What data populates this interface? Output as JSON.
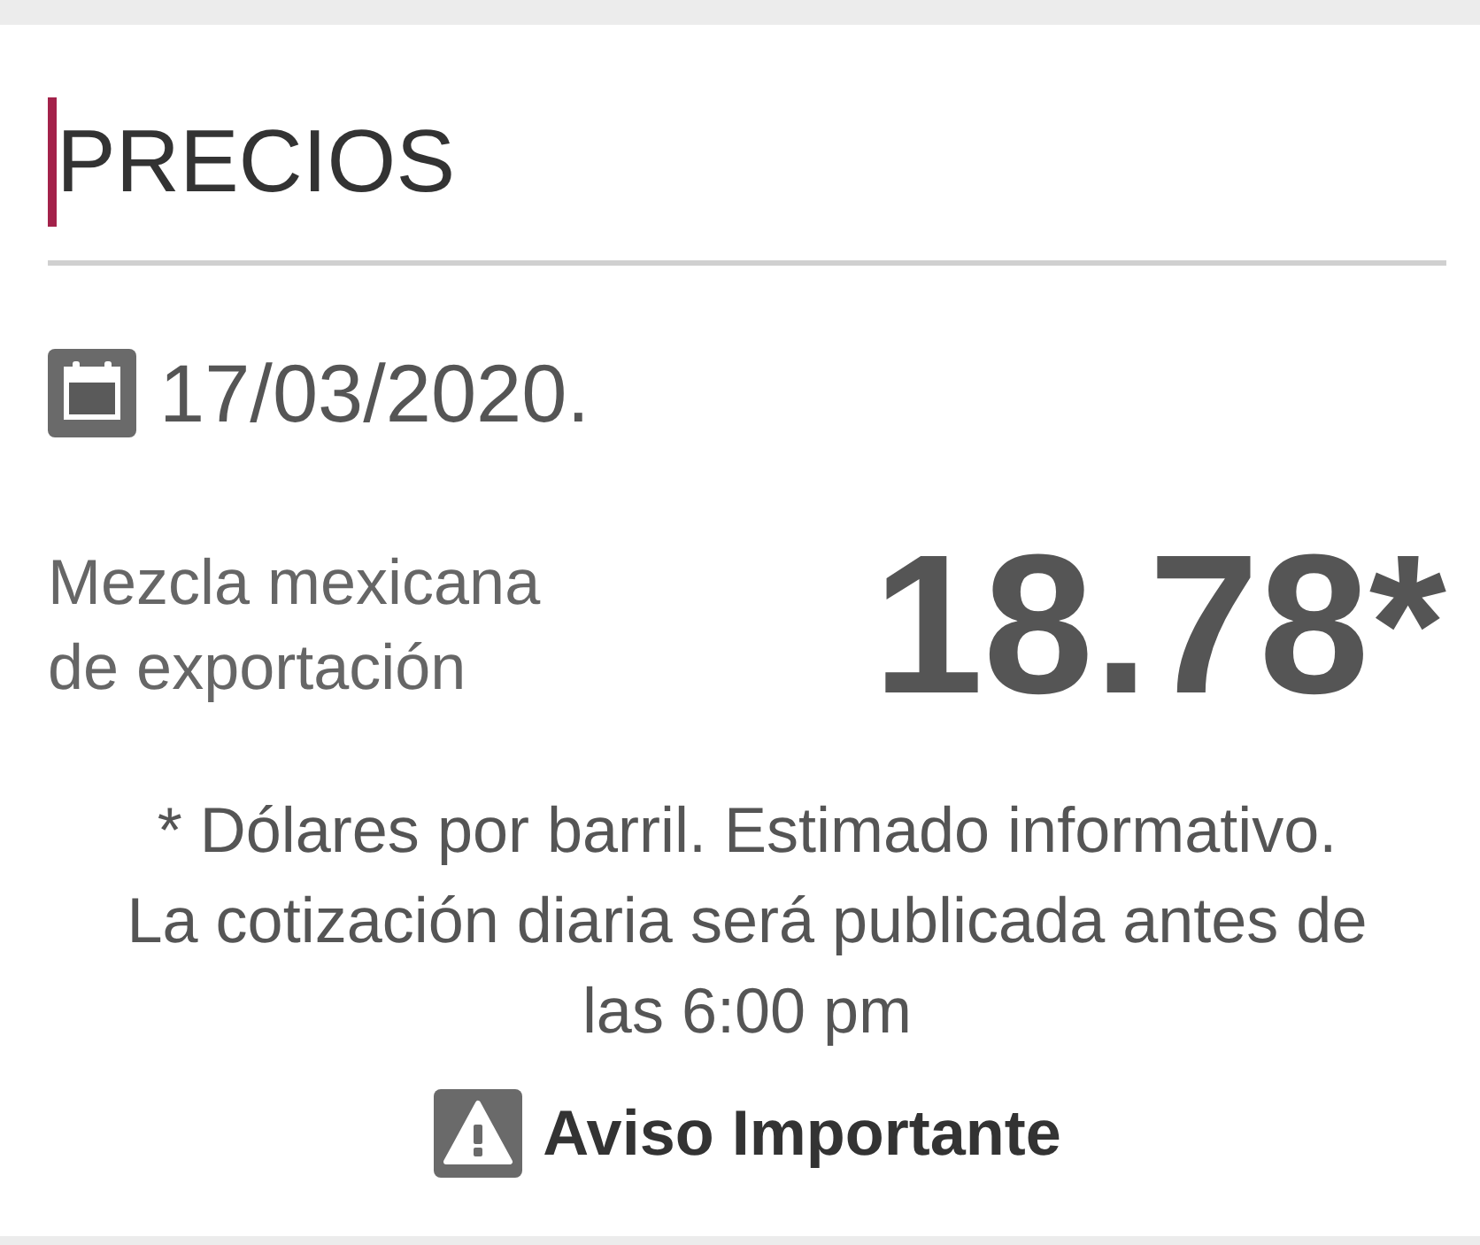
{
  "section": {
    "title": "PRECIOS"
  },
  "date": {
    "text": "17/03/2020."
  },
  "price": {
    "label": "Mezcla mexicana de exportación",
    "value": "18.78*"
  },
  "notes": [
    "* Dólares por barril. Estimado informativo.",
    "La cotización diaria será publicada antes de las 6:00 pm"
  ],
  "notice": {
    "label": "Aviso Importante"
  }
}
